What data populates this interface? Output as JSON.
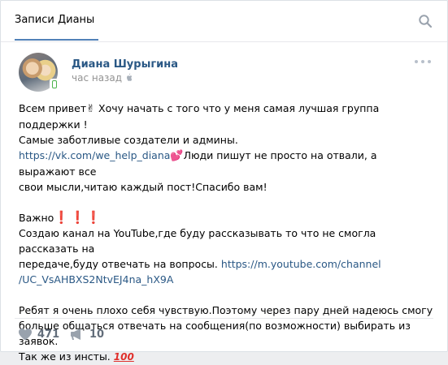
{
  "tabs": {
    "active_label": "Записи Дианы"
  },
  "post": {
    "author": "Диана Шурыгина",
    "time": "час назад",
    "text": {
      "l1a": "Всем привет",
      "l1b": " Хочу начать с того что у меня самая лучшая группа поддержки !",
      "l2": "Самые заботливые создатели и админы.",
      "link_vk": "https://vk.com/we_help_diana",
      "l3b": "Люди пишут не просто на отвали, а выражают все",
      "l4": "свои мысли,читаю каждый пост!Спасибо вам!",
      "important": "Важно",
      "l7": "Создаю канал на YouTube,где буду рассказывать то что не смогла рассказать на",
      "l8a": "передаче,буду отвечать на вопросы. ",
      "link_yt_1": "https://m.youtube.com/channel",
      "link_yt_2": "/UC_VsAHBXS2NtvEJ4na_hX9A",
      "l11": "Ребят я очень плохо себя чувствую.Поэтому через пару дней надеюсь смогу",
      "l12": "больше общаться отвечать на сообщения(по возможности) выбирать из заявок.",
      "l13": "Так же из инсты. ",
      "emoji_100": "100"
    },
    "likes": "471",
    "shares": "10"
  },
  "icons": {
    "search": "search-icon",
    "more": "more-dots-icon",
    "apple": "apple-icon",
    "mobile": "mobile-online-icon",
    "like": "heart-icon",
    "share": "megaphone-icon"
  }
}
